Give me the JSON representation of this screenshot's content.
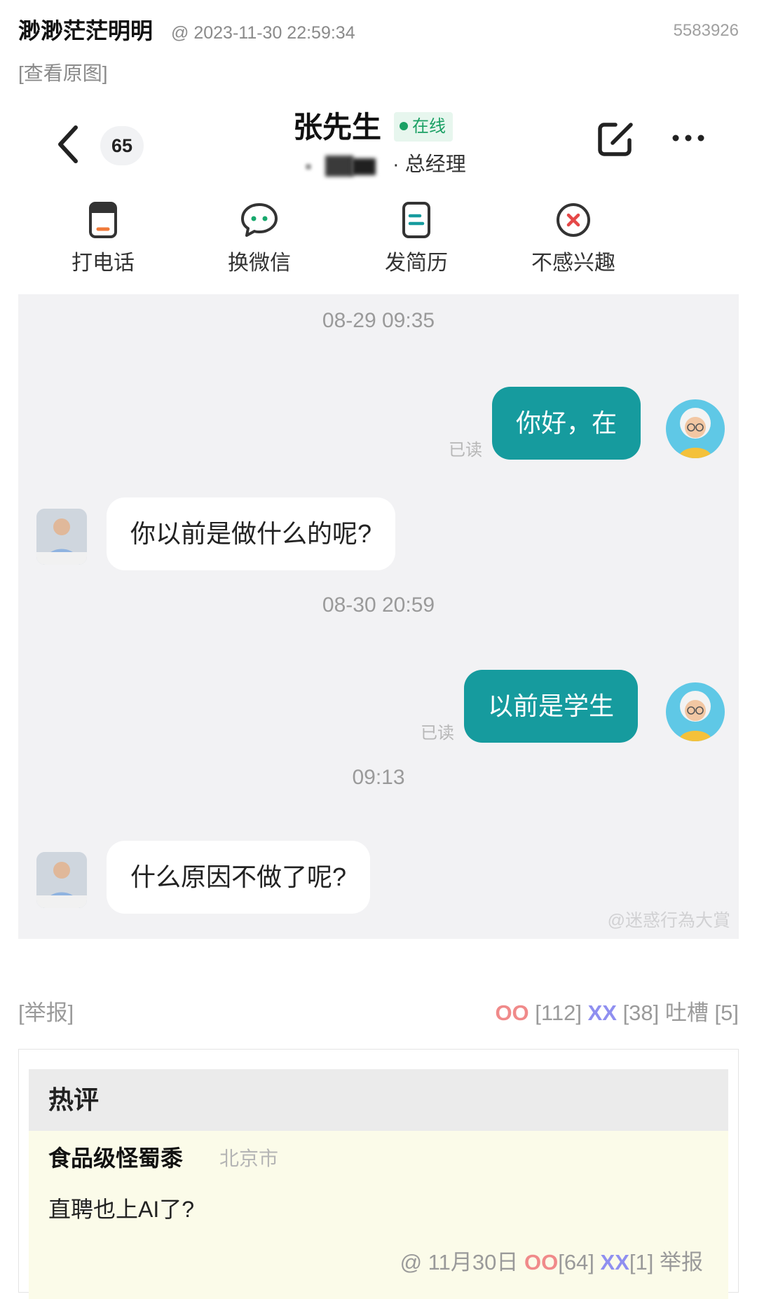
{
  "post": {
    "author": "渺渺茫茫明明",
    "timestamp": "@ 2023-11-30 22:59:34",
    "post_id": "5583926",
    "view_original": "[查看原图]"
  },
  "chat": {
    "unread_count": "65",
    "contact_name": "张先生",
    "online_status": "在线",
    "job_title": "· 总经理",
    "actions": [
      {
        "label": "打电话",
        "icon": "phone-icon"
      },
      {
        "label": "换微信",
        "icon": "wechat-icon"
      },
      {
        "label": "发简历",
        "icon": "resume-icon"
      },
      {
        "label": "不感兴趣",
        "icon": "not-interested-icon"
      }
    ],
    "messages": [
      {
        "type": "time",
        "text": "08-29 09:35"
      },
      {
        "type": "out",
        "text": "你好，在",
        "status": "已读"
      },
      {
        "type": "in",
        "text": "你以前是做什么的呢?"
      },
      {
        "type": "time",
        "text": "08-30 20:59"
      },
      {
        "type": "out",
        "text": "以前是学生",
        "status": "已读"
      },
      {
        "type": "time",
        "text": "09:13"
      },
      {
        "type": "in",
        "text": "什么原因不做了呢?"
      }
    ],
    "watermark": "@迷惑行為大賞",
    "colors": {
      "outgoing_bubble": "#169b9e",
      "online": "#1aa064",
      "chat_bg": "#f2f2f4"
    }
  },
  "footer": {
    "report": "[举报]",
    "oo_label": "OO",
    "oo_count": "[112]",
    "xx_label": "XX",
    "xx_count": "[38]",
    "comments_label": "吐槽",
    "comments_count": "[5]"
  },
  "hot_comments": {
    "title": "热评",
    "items": [
      {
        "user": "食品级怪蜀黍",
        "location": "北京市",
        "text": "直聘也上AI了?",
        "meta_prefix": "@ 11月30日",
        "oo_label": "OO",
        "oo_count": "[64]",
        "xx_label": "XX",
        "xx_count": "[1]",
        "report": "举报"
      }
    ]
  }
}
